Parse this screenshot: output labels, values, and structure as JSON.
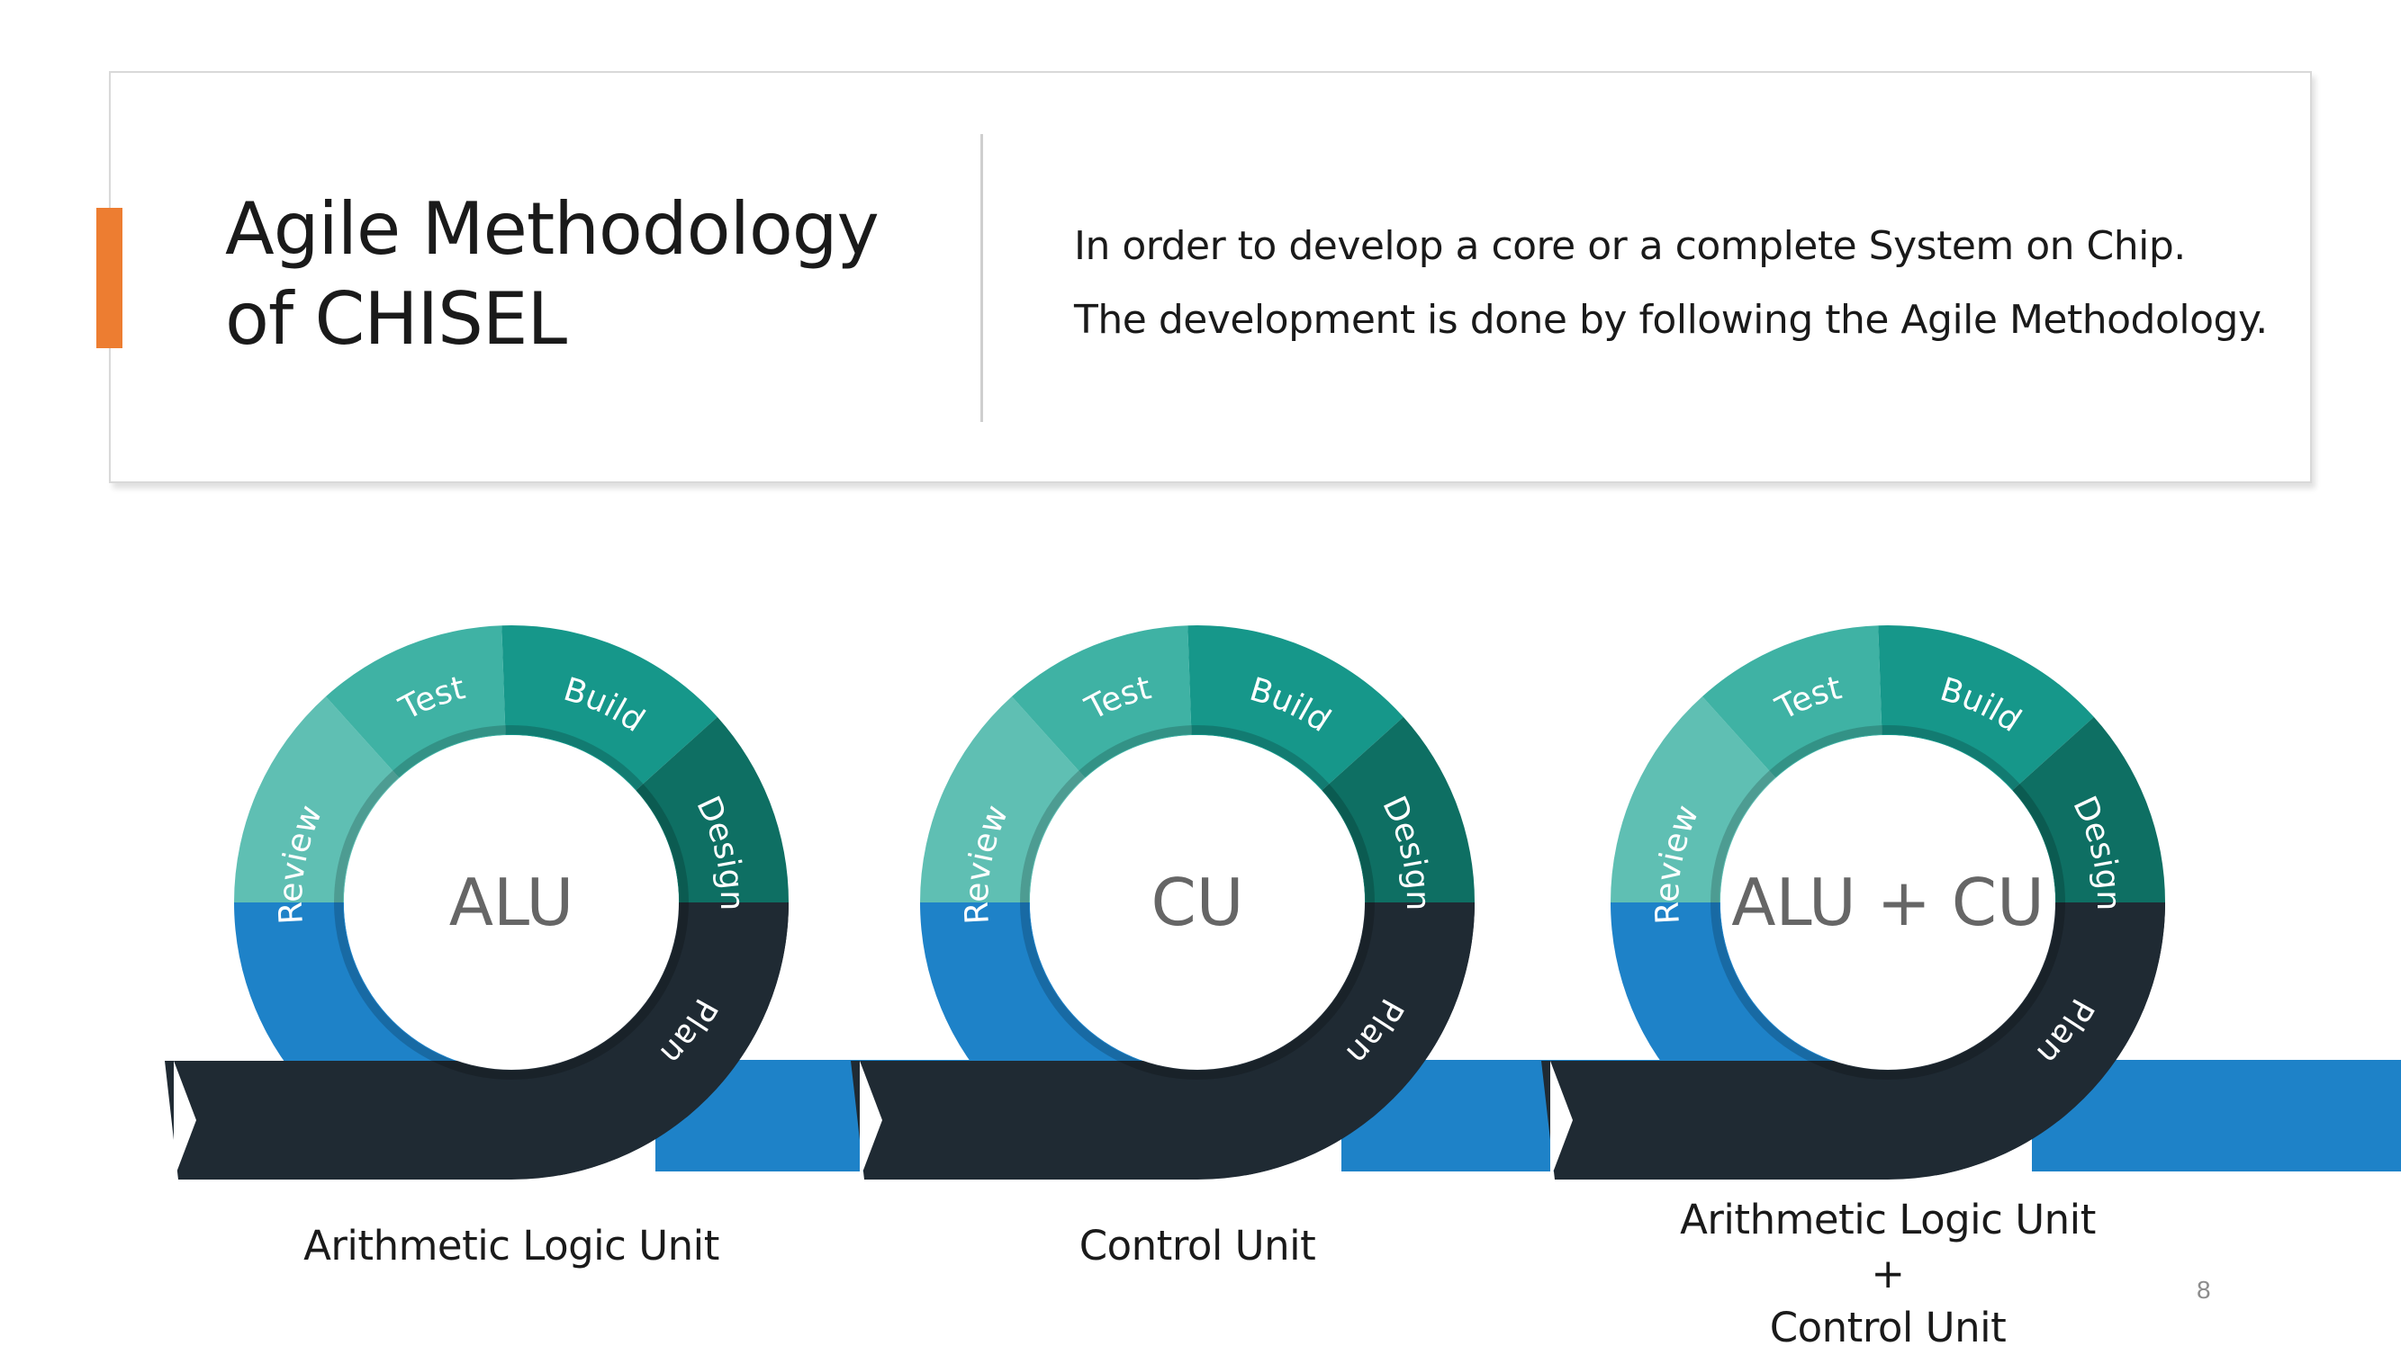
{
  "slide": {
    "title_line1": "Agile Methodology",
    "title_line2": "of CHISEL",
    "body_line1": "In order to develop a core or a complete System on Chip.",
    "body_line2": "The development is done by following the Agile Methodology.",
    "page_number": "8",
    "accent_color": "#ED7D31"
  },
  "cycles": [
    {
      "center_label": "ALU",
      "caption_lines": [
        "Arithmetic Logic Unit"
      ]
    },
    {
      "center_label": "CU",
      "caption_lines": [
        "Control Unit"
      ]
    },
    {
      "center_label": "ALU + CU",
      "caption_lines": [
        "Arithmetic Logic Unit",
        "+",
        "Control Unit"
      ]
    }
  ],
  "phase_labels": {
    "review": "Review",
    "test": "Test",
    "build": "Build",
    "design": "Design",
    "plan": "Plan"
  },
  "colors": {
    "review": "#5FBFB3",
    "test": "#3FB2A4",
    "build": "#16978A",
    "design": "#0E6F63",
    "plan": "#1F2A33",
    "arrow_blue": "#1E82C8",
    "arrow_dark": "#1F2A33"
  }
}
